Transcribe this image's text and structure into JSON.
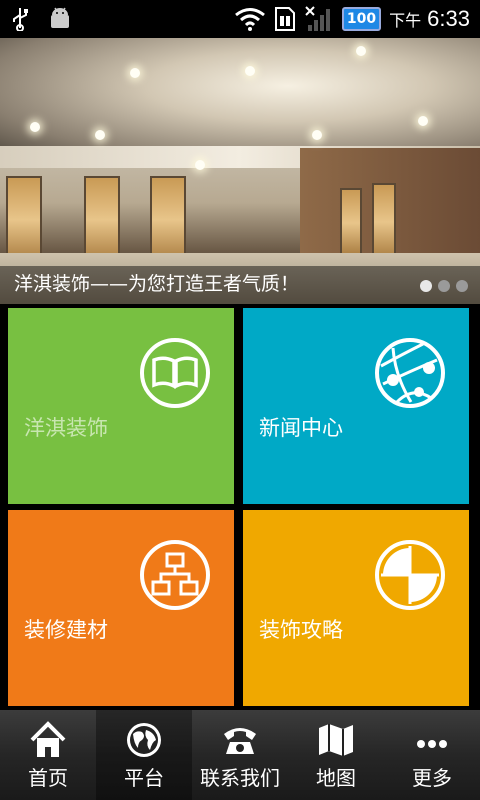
{
  "status_bar": {
    "battery_level": "100",
    "ampm": "下午",
    "time": "6:33",
    "icons": [
      "usb-icon",
      "android-debug-icon",
      "wifi-icon",
      "sim-icon",
      "signal-icon",
      "battery-icon"
    ]
  },
  "banner": {
    "caption": "洋淇装饰——为您打造王者气质！",
    "slide_count": 3,
    "active_slide": 1
  },
  "tiles": [
    {
      "label": "洋淇装饰",
      "icon": "book-icon",
      "color": "#78c041"
    },
    {
      "label": "新闻中心",
      "icon": "globe-network-icon",
      "color": "#00a9c6"
    },
    {
      "label": "装修建材",
      "icon": "sitemap-icon",
      "color": "#f07a18"
    },
    {
      "label": "装饰攻略",
      "icon": "pie-quadrant-icon",
      "color": "#f0a800"
    }
  ],
  "nav": {
    "active": "平台",
    "items": [
      {
        "label": "首页",
        "icon": "home-icon"
      },
      {
        "label": "平台",
        "icon": "globe-icon"
      },
      {
        "label": "联系我们",
        "icon": "telephone-icon"
      },
      {
        "label": "地图",
        "icon": "map-icon"
      },
      {
        "label": "更多",
        "icon": "more-icon"
      }
    ]
  }
}
